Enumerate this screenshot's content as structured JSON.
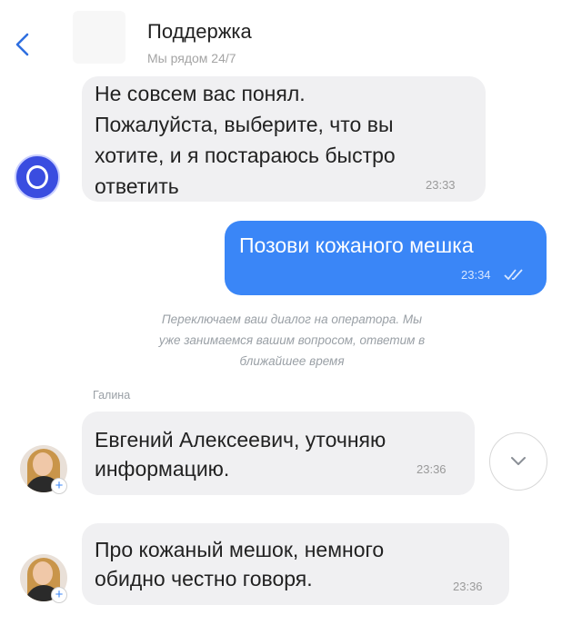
{
  "header": {
    "back_icon": "chevron-left-icon",
    "title": "Поддержка",
    "subtitle": "Мы рядом 24/7"
  },
  "messages": [
    {
      "lines": [
        "Не совсем вас понял.",
        "Пожалуйста, выберите, что вы",
        "хотите, и я постараюсь быстро",
        "ответить"
      ],
      "time": "23:33"
    },
    {
      "text": "Позови кожаного мешка",
      "time": "23:34",
      "status_icon": "double-check-icon"
    },
    {
      "lines": [
        "Евгений Алексеевич, уточняю",
        "информацию."
      ],
      "time": "23:36"
    },
    {
      "lines": [
        "Про кожаный мешок, немного",
        "обидно честно говоря."
      ],
      "time": "23:36"
    }
  ],
  "system_message": {
    "lines": [
      "Переключаем ваш диалог на оператора. Мы",
      "уже занимаемся вашим вопросом, ответим в",
      "ближайшее время"
    ]
  },
  "operator": {
    "name": "Галина"
  },
  "scroll_down_icon": "chevron-down-icon",
  "colors": {
    "outgoing_bubble": "#3a86f7",
    "incoming_bubble": "#f0f0f2",
    "bot_avatar": "#3a4de0",
    "accent": "#2f6fe0"
  }
}
